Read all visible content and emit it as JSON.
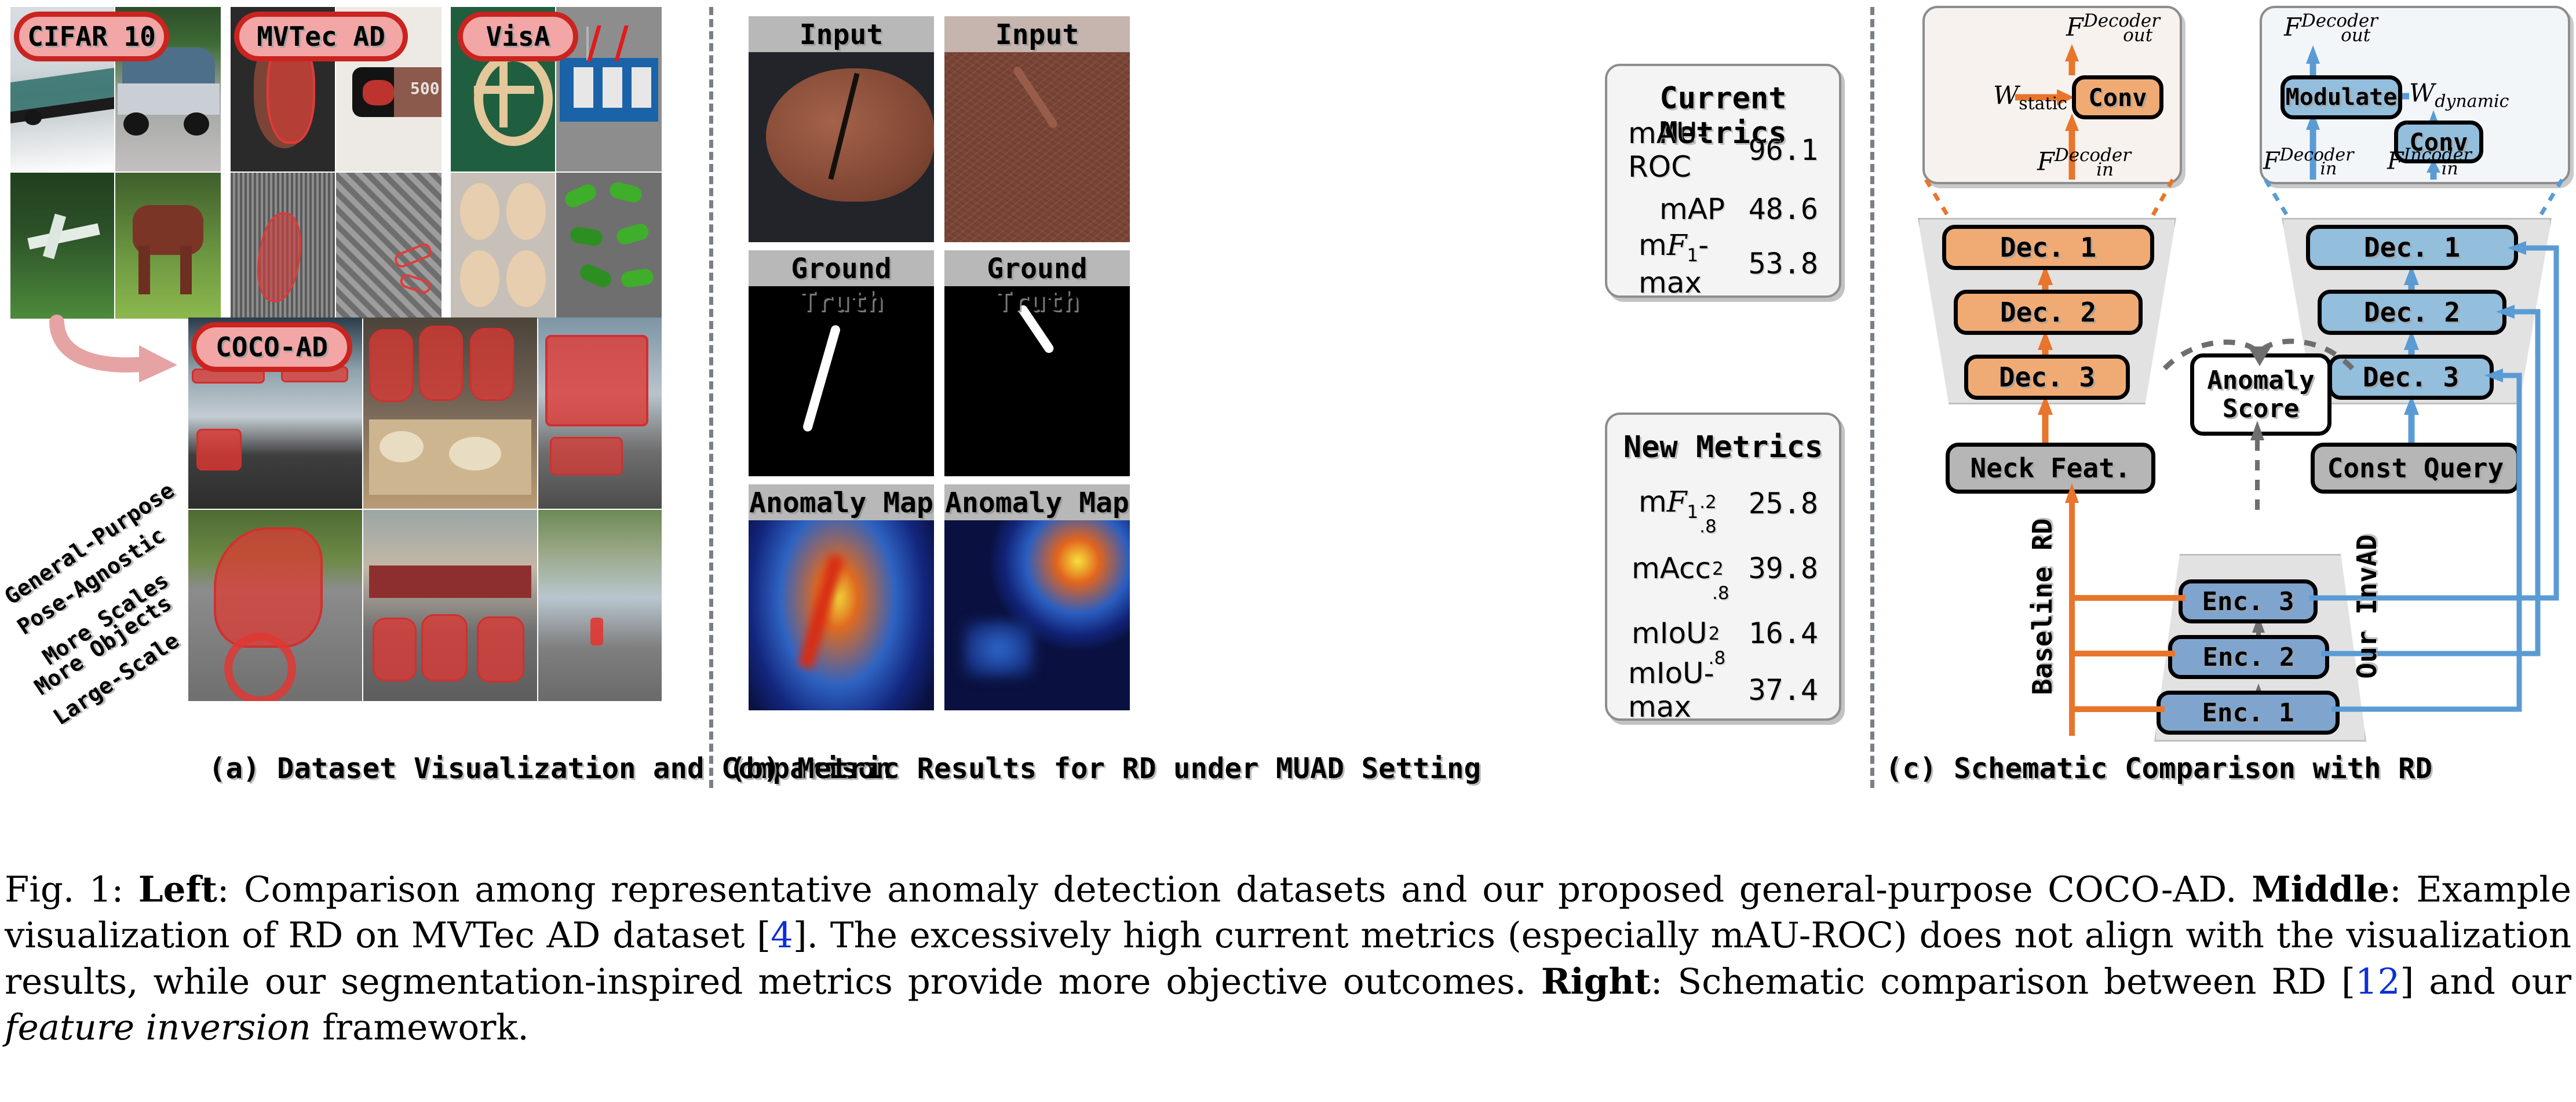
{
  "panels": {
    "a": {
      "caption": "(a) Dataset Visualization and Comparison",
      "datasets": [
        {
          "name": "CIFAR 10"
        },
        {
          "name": "MVTec AD"
        },
        {
          "name": "VisA"
        },
        {
          "name": "COCO-AD"
        }
      ],
      "attributes": [
        "General-Purpose",
        "Pose-Agnostic",
        "More Scales",
        "More Objects",
        "Large-Scale"
      ]
    },
    "b": {
      "caption": "(b) Metric Results for RD under MUAD Setting",
      "columns": [
        {
          "input_label": "Input",
          "gt_label": "Ground Truth",
          "map_label": "Anomaly Map"
        },
        {
          "input_label": "Input",
          "gt_label": "Ground Truth",
          "map_label": "Anomaly Map"
        }
      ],
      "current_metrics": {
        "title": "Current Metrics",
        "rows": [
          {
            "name": "mAU-ROC",
            "value": "96.1"
          },
          {
            "name": "mAP",
            "value": "48.6"
          },
          {
            "name": "mF1-max",
            "base": "m",
            "sym": "F",
            "sub": "1",
            "suffix": "-max",
            "value": "53.8"
          }
        ]
      },
      "new_metrics": {
        "title": "New Metrics",
        "rows": [
          {
            "name": "mF1.2.8",
            "base": "m",
            "sym": "F",
            "sub": "1",
            "sup2": ".2",
            "sub2": ".8",
            "value": "25.8"
          },
          {
            "name": "mAcc.2.8",
            "base": "mAcc",
            "sup2": "2",
            "sub2": ".8",
            "value": "39.8"
          },
          {
            "name": "mIoU.2.8",
            "base": "mIoU",
            "sup2": "2",
            "sub2": ".8",
            "value": "16.4"
          },
          {
            "name": "mIoU-max",
            "base": "mIoU-max",
            "value": "37.4"
          }
        ]
      }
    },
    "c": {
      "caption": "(c) Schematic Comparison with RD",
      "left_inset": {
        "out_label": "F_out^Decoder",
        "weight_label": "W_static",
        "conv_label": "Conv",
        "in_label": "F_in^Decoder"
      },
      "right_inset": {
        "out_label": "F_out^Decoder",
        "modulate_label": "Modulate",
        "weight_label": "W_dynamic",
        "conv_label": "Conv",
        "in_label_decoder": "F_in^Decoder",
        "in_label_encoder": "F_in^Incoder"
      },
      "left_branch_label": "Baseline RD",
      "right_branch_label": "Our InvAD",
      "anomaly_score_label": "Anomaly Score",
      "left_decoder_blocks": [
        "Dec. 1",
        "Dec. 2",
        "Dec. 3"
      ],
      "right_decoder_blocks": [
        "Dec. 1",
        "Dec. 2",
        "Dec. 3"
      ],
      "encoder_blocks": [
        "Enc. 3",
        "Enc. 2",
        "Enc. 1"
      ],
      "left_source": "Neck Feat.",
      "right_source": "Const Query"
    }
  },
  "colors": {
    "orange": "#e8752b",
    "blue": "#5a9bd4",
    "orange_fill": "#f0ab74",
    "blue_fill": "#93bedc",
    "badge_fill": "#f3a6a6",
    "badge_border": "#c9241f",
    "grey_fill": "#b6b6b6",
    "cite": "#0b2fd8"
  },
  "caption": {
    "fig_label": "Fig. 1:",
    "b1": "Left",
    "t1": ": Comparison among representative anomaly detection datasets and our proposed general-purpose COCO-AD. ",
    "b2": "Middle",
    "t2": ": Example visualization of RD on MVTec AD dataset [",
    "cite1": "4",
    "t3": "]. The excessively high current metrics (especially mAU-ROC) does not align with the visualization results, while our segmentation-inspired metrics provide more objective outcomes. ",
    "b3": "Right",
    "t4": ": Schematic comparison between RD [",
    "cite2": "12",
    "t5": "] and our ",
    "it1": "feature inversion",
    "t6": " framework."
  }
}
